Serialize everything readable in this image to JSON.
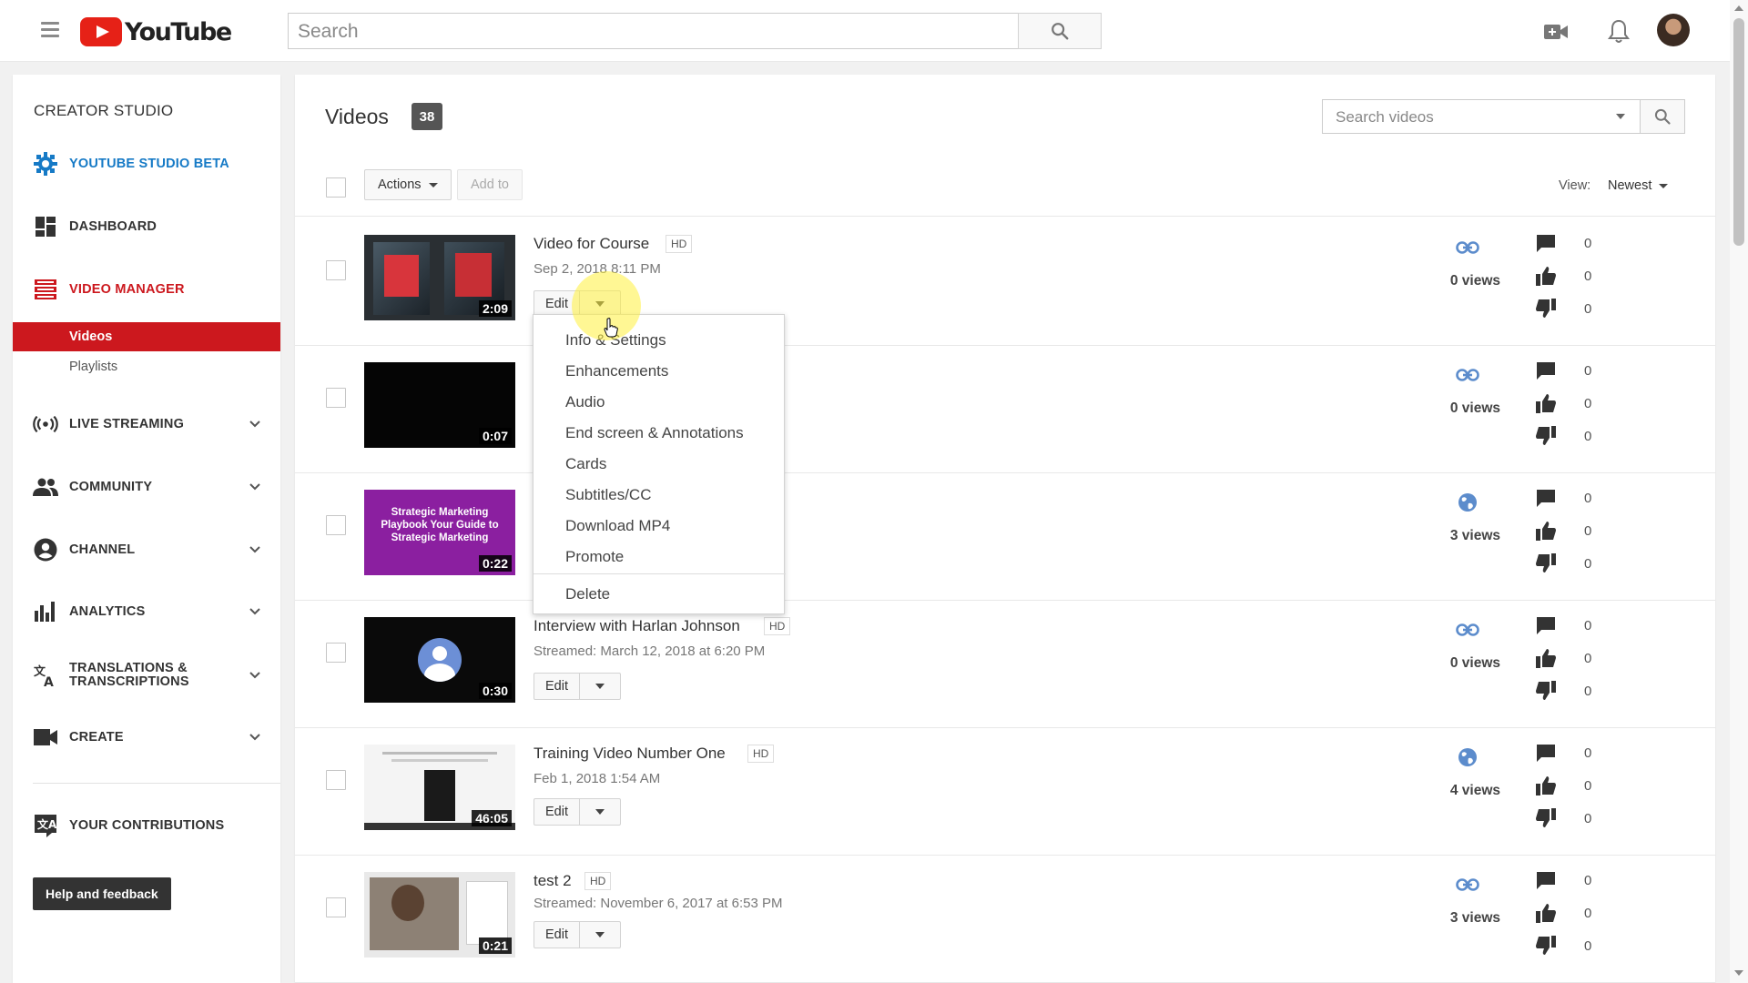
{
  "header": {
    "logo_text": "YouTube",
    "search_placeholder": "Search"
  },
  "sidebar": {
    "title": "CREATOR STUDIO",
    "studio_beta": "YOUTUBE STUDIO BETA",
    "dashboard": "DASHBOARD",
    "video_manager": "VIDEO MANAGER",
    "sub_videos": "Videos",
    "sub_playlists": "Playlists",
    "live_streaming": "LIVE STREAMING",
    "community": "COMMUNITY",
    "channel": "CHANNEL",
    "analytics": "ANALYTICS",
    "translations_line1": "TRANSLATIONS &",
    "translations_line2": "TRANSCRIPTIONS",
    "create": "CREATE",
    "contributions": "YOUR CONTRIBUTIONS",
    "help": "Help and feedback"
  },
  "main": {
    "title": "Videos",
    "count": "38",
    "search_placeholder": "Search videos",
    "actions_label": "Actions",
    "add_to_label": "Add to",
    "view_label": "View:",
    "view_value": "Newest",
    "edit_label": "Edit"
  },
  "videos": [
    {
      "title": "Video for Course",
      "hd": "HD",
      "date": "Sep 2, 2018 8:11 PM",
      "duration": "2:09",
      "privacy": "unlisted-link-icon",
      "views": "0 views",
      "comments": "0",
      "likes": "0",
      "dislikes": "0"
    },
    {
      "title": "",
      "hd": "",
      "date": "",
      "duration": "0:07",
      "privacy": "unlisted-link-icon",
      "views": "0 views",
      "comments": "0",
      "likes": "0",
      "dislikes": "0"
    },
    {
      "title": "",
      "hd": "",
      "date": "",
      "duration": "0:22",
      "privacy": "public-globe-icon",
      "views": "3 views",
      "comments": "0",
      "likes": "0",
      "dislikes": "0",
      "thumb_text": "Strategic Marketing Playbook Your Guide to Strategic Marketing"
    },
    {
      "title": "Interview with Harlan Johnson",
      "hd": "HD",
      "date": "Streamed: March 12, 2018 at 6:20 PM",
      "duration": "0:30",
      "privacy": "unlisted-link-icon",
      "views": "0 views",
      "comments": "0",
      "likes": "0",
      "dislikes": "0"
    },
    {
      "title": "Training Video Number One",
      "hd": "HD",
      "date": "Feb 1, 2018 1:54 AM",
      "duration": "46:05",
      "privacy": "public-globe-icon",
      "views": "4 views",
      "comments": "0",
      "likes": "0",
      "dislikes": "0"
    },
    {
      "title": "test 2",
      "hd": "HD",
      "date": "Streamed: November 6, 2017 at 6:53 PM",
      "duration": "0:21",
      "privacy": "unlisted-link-icon",
      "views": "3 views",
      "comments": "0",
      "likes": "0",
      "dislikes": "0"
    }
  ],
  "edit_menu": [
    "Info & Settings",
    "Enhancements",
    "Audio",
    "End screen & Annotations",
    "Cards",
    "Subtitles/CC",
    "Download MP4",
    "Promote",
    "Delete"
  ],
  "colors": {
    "accent_red": "#cc181e",
    "link_blue": "#167ac6",
    "youtube_red": "#e62117"
  }
}
